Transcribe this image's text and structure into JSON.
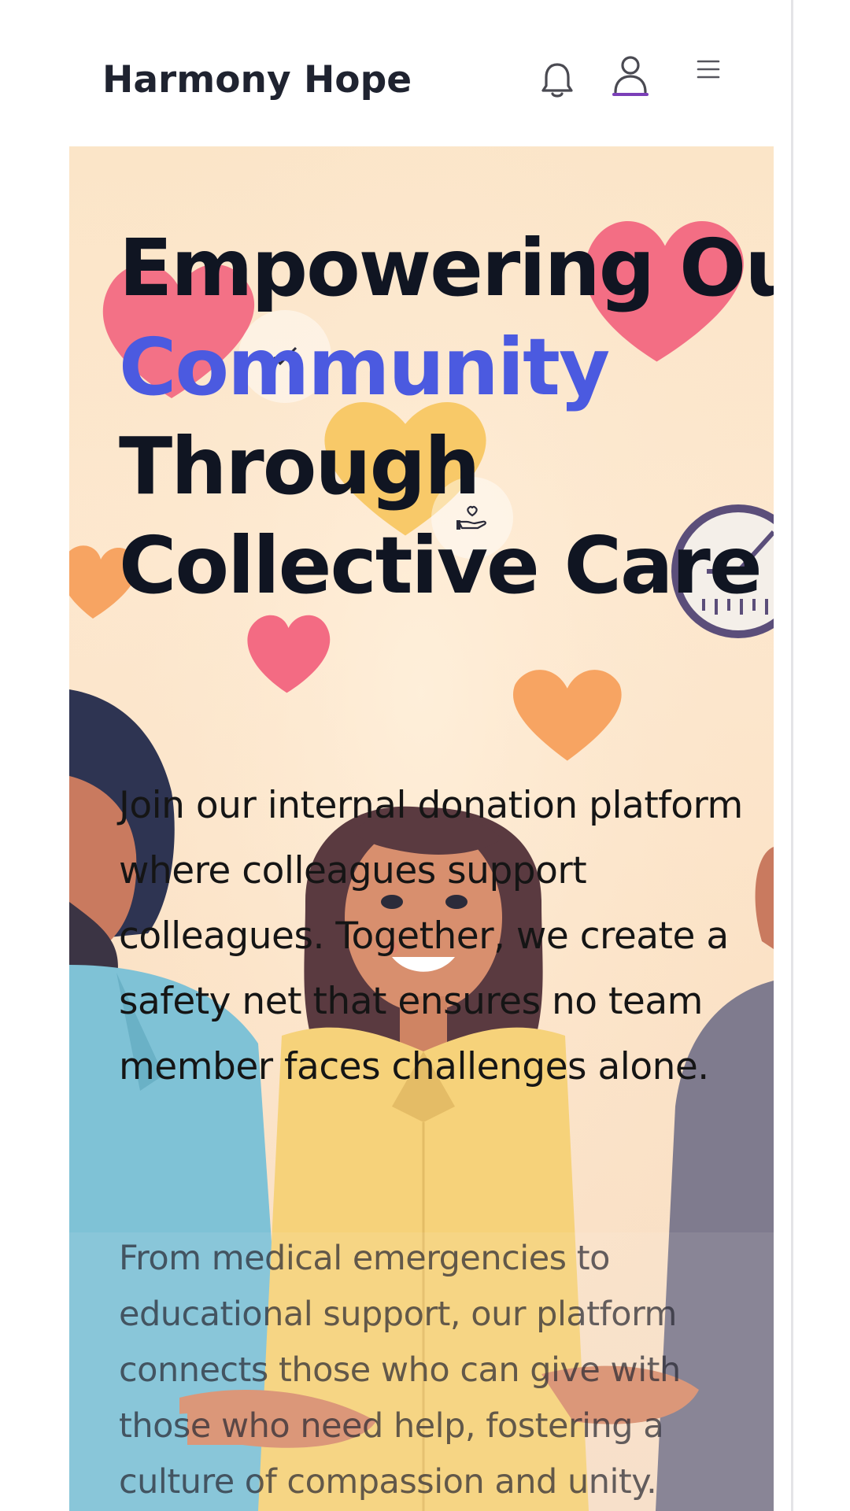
{
  "header": {
    "brand": "Harmony Hope",
    "icons": [
      "bell-icon",
      "user-icon",
      "menu-icon"
    ],
    "active_icon": "user-icon",
    "accent_underline": "#7b3fb8"
  },
  "hero": {
    "headline_line1": "Empowering Our",
    "headline_line2": "Community",
    "headline_line3": "Through",
    "headline_line4": "Collective Care",
    "accent_color": "#4b5ae0",
    "lead_lines": [
      "Join our internal donation platform",
      "where colleagues support",
      "colleagues. Together, we create a",
      "safety net that ensures no team",
      "member faces challenges alone."
    ],
    "sub_lines": [
      "From medical emergencies to",
      "educational support, our platform",
      "connects those who can give with",
      "those who need help, fostering a",
      "culture of compassion and unity."
    ],
    "decor": [
      "heart-icon",
      "clock-icon",
      "heart-hand-icon",
      "check-icon"
    ]
  }
}
